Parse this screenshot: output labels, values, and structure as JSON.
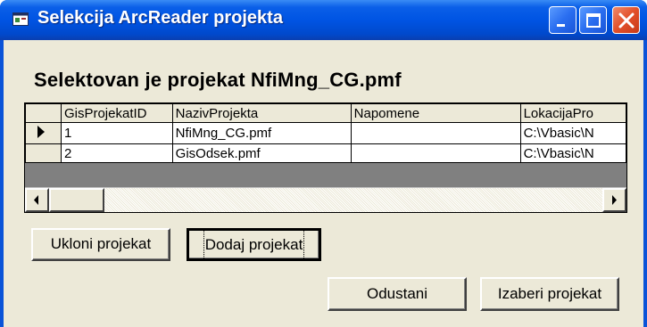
{
  "window": {
    "title": "Selekcija ArcReader projekta",
    "controls": [
      "minimize-icon",
      "maximize-icon",
      "close-icon"
    ],
    "colors": {
      "titlebar": "#0054e3",
      "close": "#e2502a",
      "client": "#ece9d8"
    }
  },
  "heading": "Selektovan je projekat  NfiMng_CG.pmf",
  "grid": {
    "columns": [
      "",
      "GisProjekatID",
      "NazivProjekta",
      "Napomene",
      "LokacijaPro"
    ],
    "rows": [
      {
        "selected": true,
        "cells": [
          "1",
          "NfiMng_CG.pmf",
          "",
          "C:\\Vbasic\\N"
        ]
      },
      {
        "selected": false,
        "cells": [
          "2",
          "GisOdsek.pmf",
          "",
          "C:\\Vbasic\\N"
        ]
      }
    ]
  },
  "buttons": {
    "remove": "Ukloni projekat",
    "add": "Dodaj projekat",
    "cancel": "Odustani",
    "choose": "Izaberi projekat"
  }
}
